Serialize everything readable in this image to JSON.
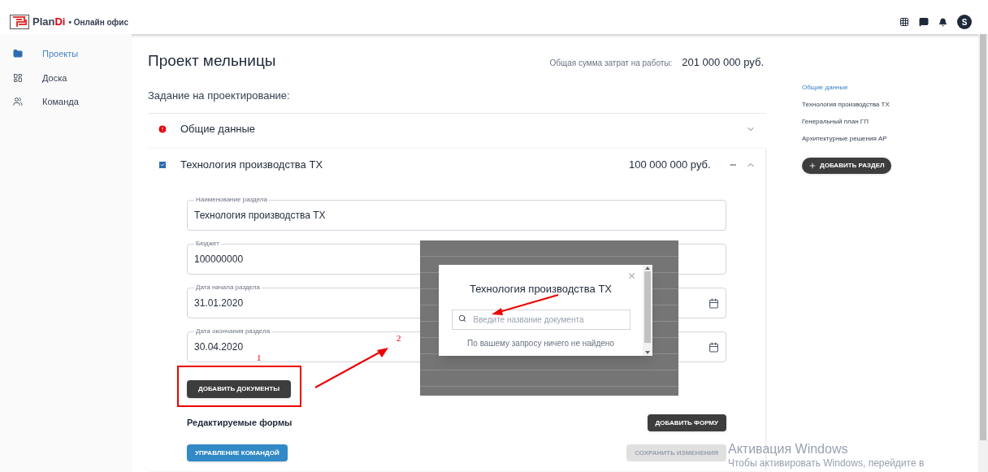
{
  "header": {
    "brand_plan": "Plan",
    "brand_di": "Di",
    "brand_suffix": "• Онлайн офис",
    "avatar": "S"
  },
  "sidebar": {
    "items": [
      {
        "label": "Проекты",
        "selected": true
      },
      {
        "label": "Доска",
        "selected": false
      },
      {
        "label": "Команда",
        "selected": false
      }
    ]
  },
  "project": {
    "title": "Проект мельницы",
    "total_label": "Общая сумма затрат на работы:",
    "total_value": "201 000 000 руб.",
    "subtitle": "Задание на проектирование:"
  },
  "sections": [
    {
      "title": "Общие данные",
      "kind": "error",
      "expanded": false
    },
    {
      "title": "Технология производства ТХ",
      "kind": "ok",
      "expanded": true,
      "amount": "100 000 000 руб.",
      "more": "•••",
      "fields": [
        {
          "label": "Наименование раздела",
          "value": "Технология производства ТХ",
          "kind": "text"
        },
        {
          "label": "Бюджет",
          "value": "100000000",
          "kind": "text"
        },
        {
          "label": "Дата начала раздела",
          "value": "31.01.2020",
          "kind": "date"
        },
        {
          "label": "Дата окончания раздела",
          "value": "30.04.2020",
          "kind": "date"
        }
      ],
      "add_documents": "ДОБАВИТЬ ДОКУМЕНТЫ",
      "forms_label": "Редактируемые формы",
      "add_form": "ДОБАВИТЬ ФОРМУ",
      "team_button": "УПРАВЛЕНИЕ КОМАНДОЙ",
      "save_button": {
        "label": "СОХРАНИТЬ ИЗМЕНЕНИЯ",
        "disabled": true
      }
    }
  ],
  "toc": {
    "items": [
      {
        "label": "Общие данные",
        "selected": true
      },
      {
        "label": "Технология производства ТХ",
        "selected": false
      },
      {
        "label": "Генеральный план ГП",
        "selected": false
      },
      {
        "label": "Архитектурные решения АР",
        "selected": false
      }
    ],
    "add_button": "ДОБАВИТЬ РАЗДЕЛ"
  },
  "dialog": {
    "title": "Технология производства ТХ",
    "placeholder": "Введите название документа",
    "empty_message": "По вашему запросу ничего не найдено"
  },
  "annotations": {
    "mark_1": "1",
    "mark_2": "2"
  },
  "windows_notice": {
    "title": "Активация Windows",
    "text": "Чтобы активировать Windows, перейдите в"
  }
}
